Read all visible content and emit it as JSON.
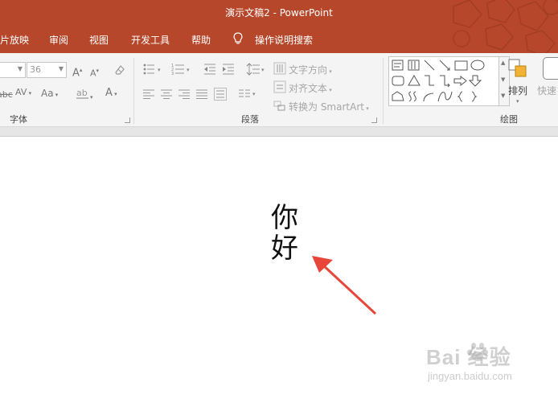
{
  "window": {
    "title": "演示文稿2  -  PowerPoint"
  },
  "colors": {
    "accent": "#b7472a",
    "arrow": "#e8463a"
  },
  "tabs": [
    {
      "label": "片放映"
    },
    {
      "label": "审阅"
    },
    {
      "label": "视图"
    },
    {
      "label": "开发工具"
    },
    {
      "label": "帮助"
    }
  ],
  "tell_me": {
    "label": "操作说明搜索",
    "icon": "lightbulb-icon"
  },
  "ribbon": {
    "font_size_value": "36",
    "text_direction_label": "文字方向",
    "align_text_label": "对齐文本",
    "smartart_label": "转换为 SmartArt",
    "arrange_label": "排列",
    "quick_styles_label": "快速",
    "groups": {
      "font": "字体",
      "paragraph": "段落",
      "drawing": "绘图"
    },
    "font_glyphs": {
      "grow": "A",
      "shrink": "A",
      "spacing": "AV",
      "case": "Aa",
      "color": "A",
      "strike": "abc"
    }
  },
  "slide": {
    "text_lines": [
      "你",
      "好"
    ]
  },
  "watermark": {
    "brand": "Bai 经验",
    "url": "jingyan.baidu.com"
  }
}
